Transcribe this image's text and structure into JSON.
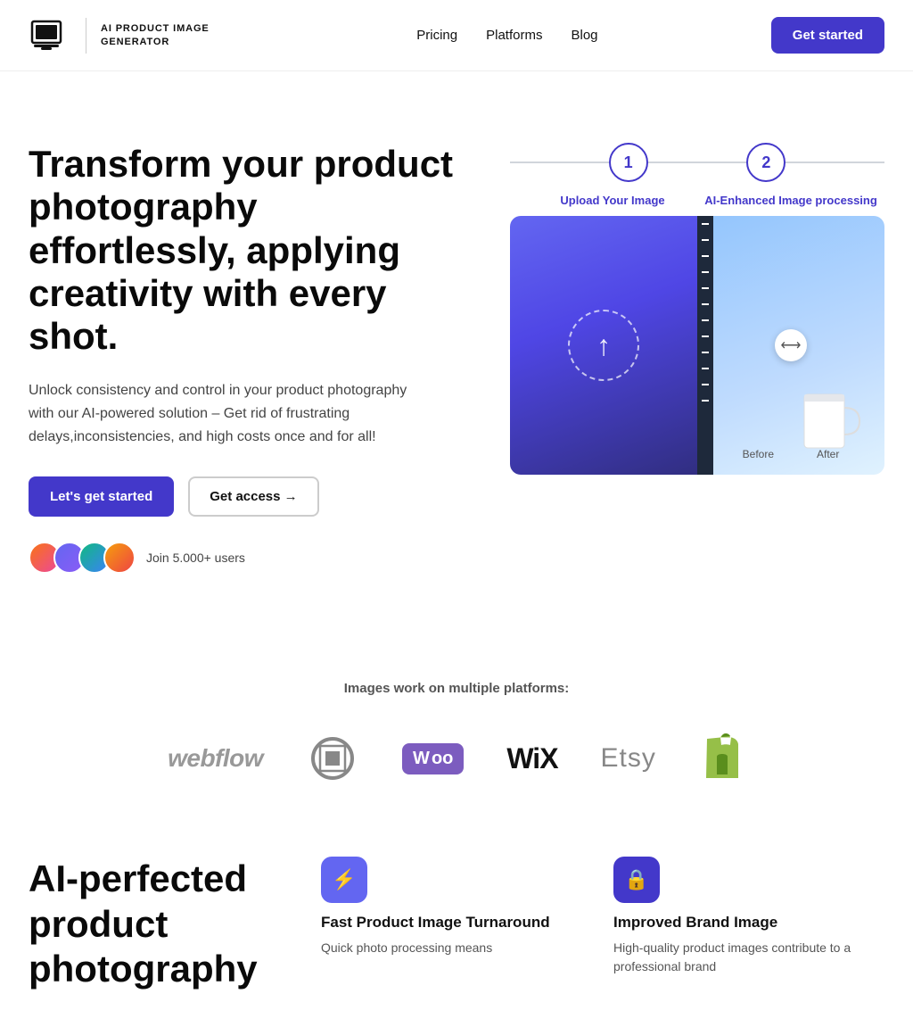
{
  "nav": {
    "logo_title": "AI PRODUCT IMAGE GENERATOR",
    "links": [
      {
        "label": "Pricing",
        "id": "pricing"
      },
      {
        "label": "Platforms",
        "id": "platforms"
      },
      {
        "label": "Blog",
        "id": "blog"
      }
    ],
    "cta_label": "Get started"
  },
  "hero": {
    "title": "Transform your product photography effortlessly, applying creativity with every shot.",
    "description": "Unlock consistency and control in your product photography with our AI-powered solution – Get rid of frustrating delays,inconsistencies, and high costs once and for all!",
    "btn_primary": "Let's get started",
    "btn_secondary": "Get access →",
    "social_text": "Join 5.000+ users",
    "step1_label": "Upload Your Image",
    "step2_label": "AI-Enhanced Image processing",
    "before_label": "Before",
    "after_label": "After"
  },
  "platforms": {
    "title": "Images work on multiple platforms:",
    "items": [
      "webflow",
      "squarespace",
      "WooCommerce",
      "Wix",
      "Etsy",
      "Shopify"
    ]
  },
  "features": {
    "title": "AI-perfected product photography",
    "cards": [
      {
        "icon": "⚡",
        "icon_color": "purple",
        "title": "Fast Product Image Turnaround",
        "description": "Quick photo processing means"
      },
      {
        "icon": "🔒",
        "icon_color": "indigo",
        "title": "Improved Brand Image",
        "description": "High-quality product images contribute to a professional brand"
      }
    ]
  }
}
